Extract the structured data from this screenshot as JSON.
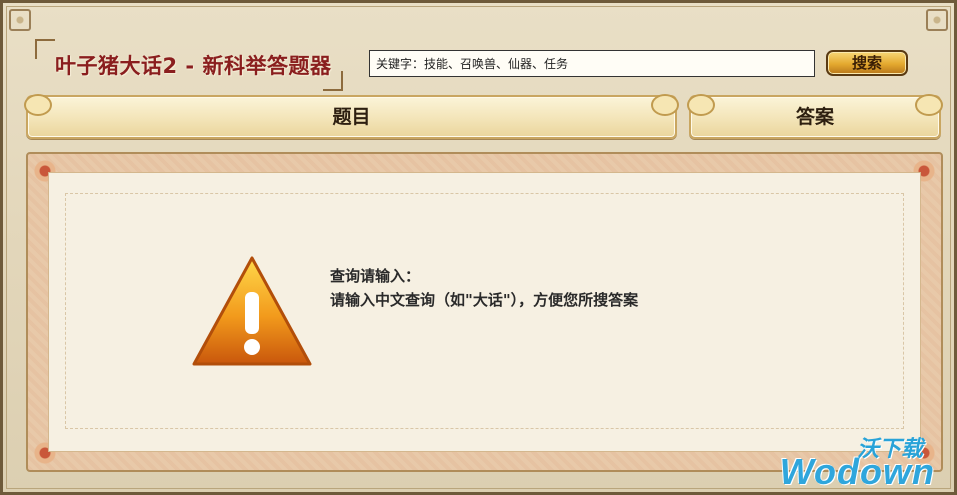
{
  "app": {
    "title": "叶子猪大话2 - 新科举答题器"
  },
  "search": {
    "value": "关键字：技能、召唤兽、仙器、任务",
    "button_label": "搜索"
  },
  "headers": {
    "question": "题目",
    "answer": "答案"
  },
  "message": {
    "title": "查询请输入：",
    "body": "请输入中文查询（如\"大话\"），方便您所搜答案"
  },
  "icons": {
    "warning": "warning-icon"
  },
  "watermark": {
    "cn": "沃下载",
    "en": "Wodown"
  },
  "colors": {
    "title": "#8a1e1e",
    "button": "#e4a92f",
    "warning": "#f0a020",
    "watermark": "#2fa6dc"
  }
}
